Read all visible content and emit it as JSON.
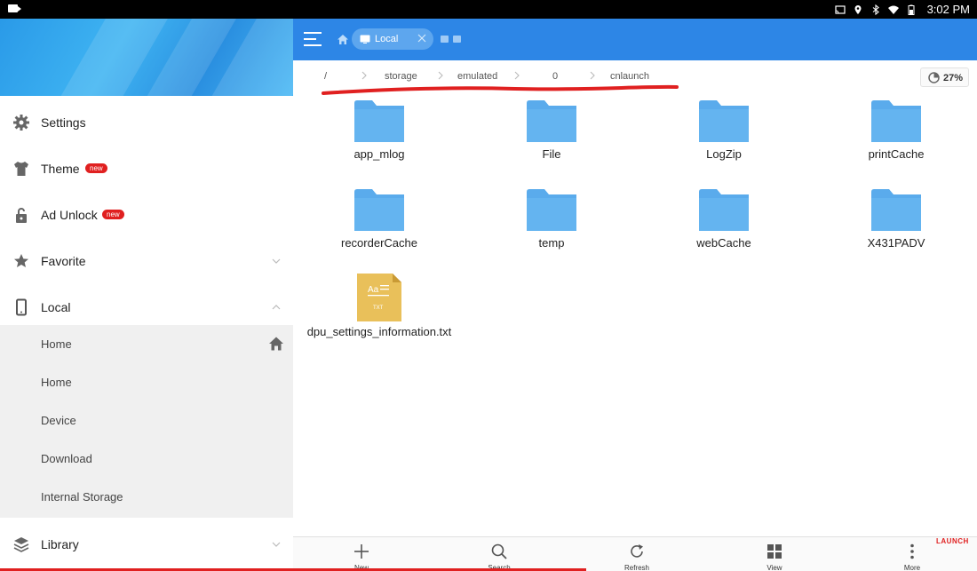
{
  "status_bar": {
    "time": "3:02 PM"
  },
  "sidebar": {
    "items": [
      {
        "label": "Settings",
        "icon": "gear-icon",
        "badge": ""
      },
      {
        "label": "Theme",
        "icon": "shirt-icon",
        "badge": "new"
      },
      {
        "label": "Ad Unlock",
        "icon": "lock-icon",
        "badge": "new"
      },
      {
        "label": "Favorite",
        "icon": "star-icon",
        "badge": ""
      },
      {
        "label": "Local",
        "icon": "phone-icon",
        "badge": ""
      }
    ],
    "local_sub": [
      "Home",
      "Home",
      "Device",
      "Download",
      "Internal Storage"
    ],
    "library_label": "Library"
  },
  "topbar": {
    "tab_label": "Local"
  },
  "path": {
    "segments": [
      "/",
      "storage",
      "emulated",
      "0",
      "cnlaunch"
    ]
  },
  "storage": {
    "percent": "27%"
  },
  "files": [
    {
      "name": "app_mlog",
      "type": "folder"
    },
    {
      "name": "File",
      "type": "folder"
    },
    {
      "name": "LogZip",
      "type": "folder"
    },
    {
      "name": "printCache",
      "type": "folder"
    },
    {
      "name": "recorderCache",
      "type": "folder"
    },
    {
      "name": "temp",
      "type": "folder"
    },
    {
      "name": "webCache",
      "type": "folder"
    },
    {
      "name": "X431PADV",
      "type": "folder"
    },
    {
      "name": "dpu_settings_information.txt",
      "type": "txt",
      "icon_text_top": "Aa",
      "icon_text_bottom": "TXT"
    }
  ],
  "bottom_bar": {
    "buttons": [
      {
        "label": "New",
        "icon": "plus-icon"
      },
      {
        "label": "Search",
        "icon": "search-icon"
      },
      {
        "label": "Refresh",
        "icon": "refresh-icon"
      },
      {
        "label": "View",
        "icon": "grid-view-icon"
      },
      {
        "label": "More",
        "icon": "more-icon"
      }
    ]
  },
  "watermark": "LAUNCH",
  "colors": {
    "accent": "#2d86e6",
    "folder": "#5aabec",
    "badge": "#e02020",
    "annotation": "#e02020"
  }
}
